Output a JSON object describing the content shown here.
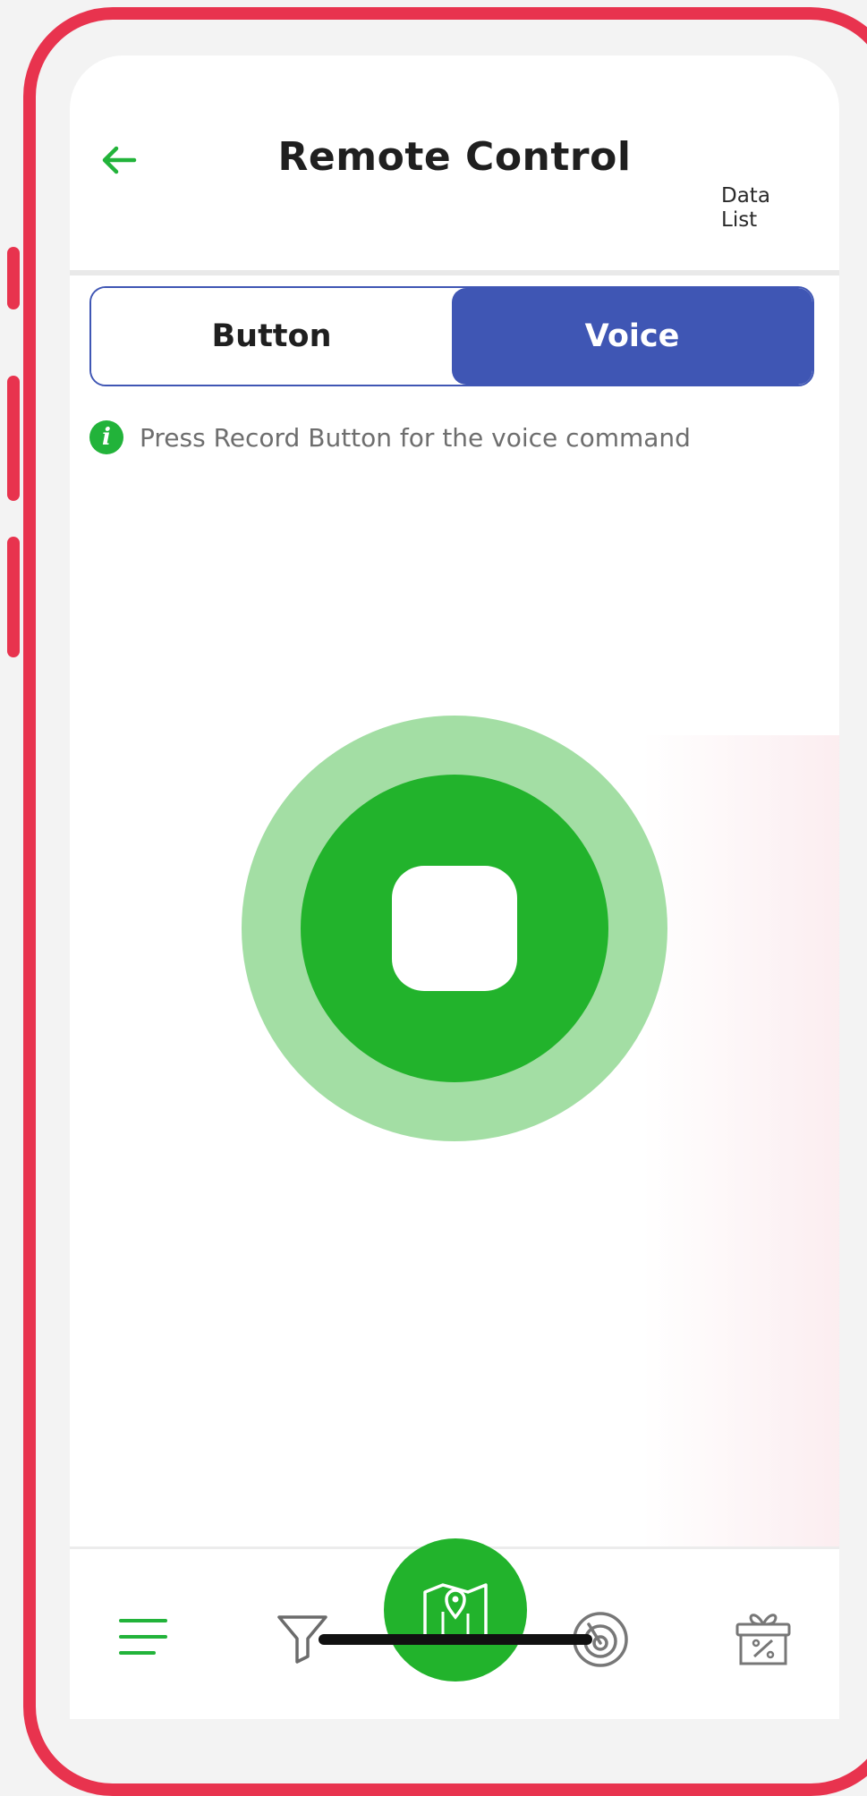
{
  "header": {
    "title": "Remote Control",
    "data_list_line1": "Data",
    "data_list_line2": "List"
  },
  "segment": {
    "button_label": "Button",
    "voice_label": "Voice",
    "active": "Voice"
  },
  "info": {
    "icon_glyph": "i",
    "text": "Press Record Button for the voice command"
  },
  "recorder": {
    "state": "recording"
  },
  "bottom_nav": {
    "items": [
      "menu-icon",
      "filter-icon",
      "map-icon",
      "radar-icon",
      "gift-icon"
    ],
    "active": "map-icon"
  },
  "colors": {
    "frame": "#e8334e",
    "accent_green": "#22b32c",
    "accent_green_light": "#a3dea4",
    "segment_blue": "#3f56b4",
    "info_text": "#6e6e6e"
  }
}
